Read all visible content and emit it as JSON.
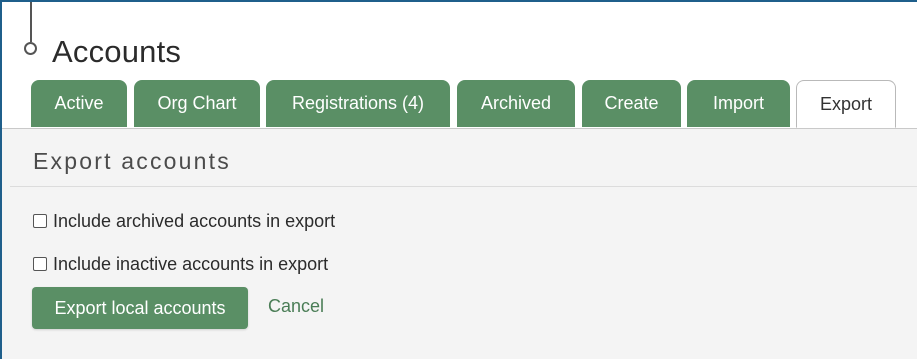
{
  "page": {
    "title": "Accounts"
  },
  "tabs": [
    {
      "label": "Active"
    },
    {
      "label": "Org Chart"
    },
    {
      "label": "Registrations (4)"
    },
    {
      "label": "Archived"
    },
    {
      "label": "Create"
    },
    {
      "label": "Import"
    },
    {
      "label": "Export",
      "active": true
    }
  ],
  "export": {
    "section_title": "Export accounts",
    "options": [
      {
        "label": "Include archived accounts in export",
        "checked": false
      },
      {
        "label": "Include inactive accounts in export",
        "checked": false
      }
    ],
    "submit_label": "Export local accounts",
    "cancel_label": "Cancel"
  },
  "colors": {
    "tab_green": "#5a8f65",
    "button_green": "#5a8f65",
    "link_green": "#4a7d56",
    "frame_blue": "#1f5f8b"
  }
}
